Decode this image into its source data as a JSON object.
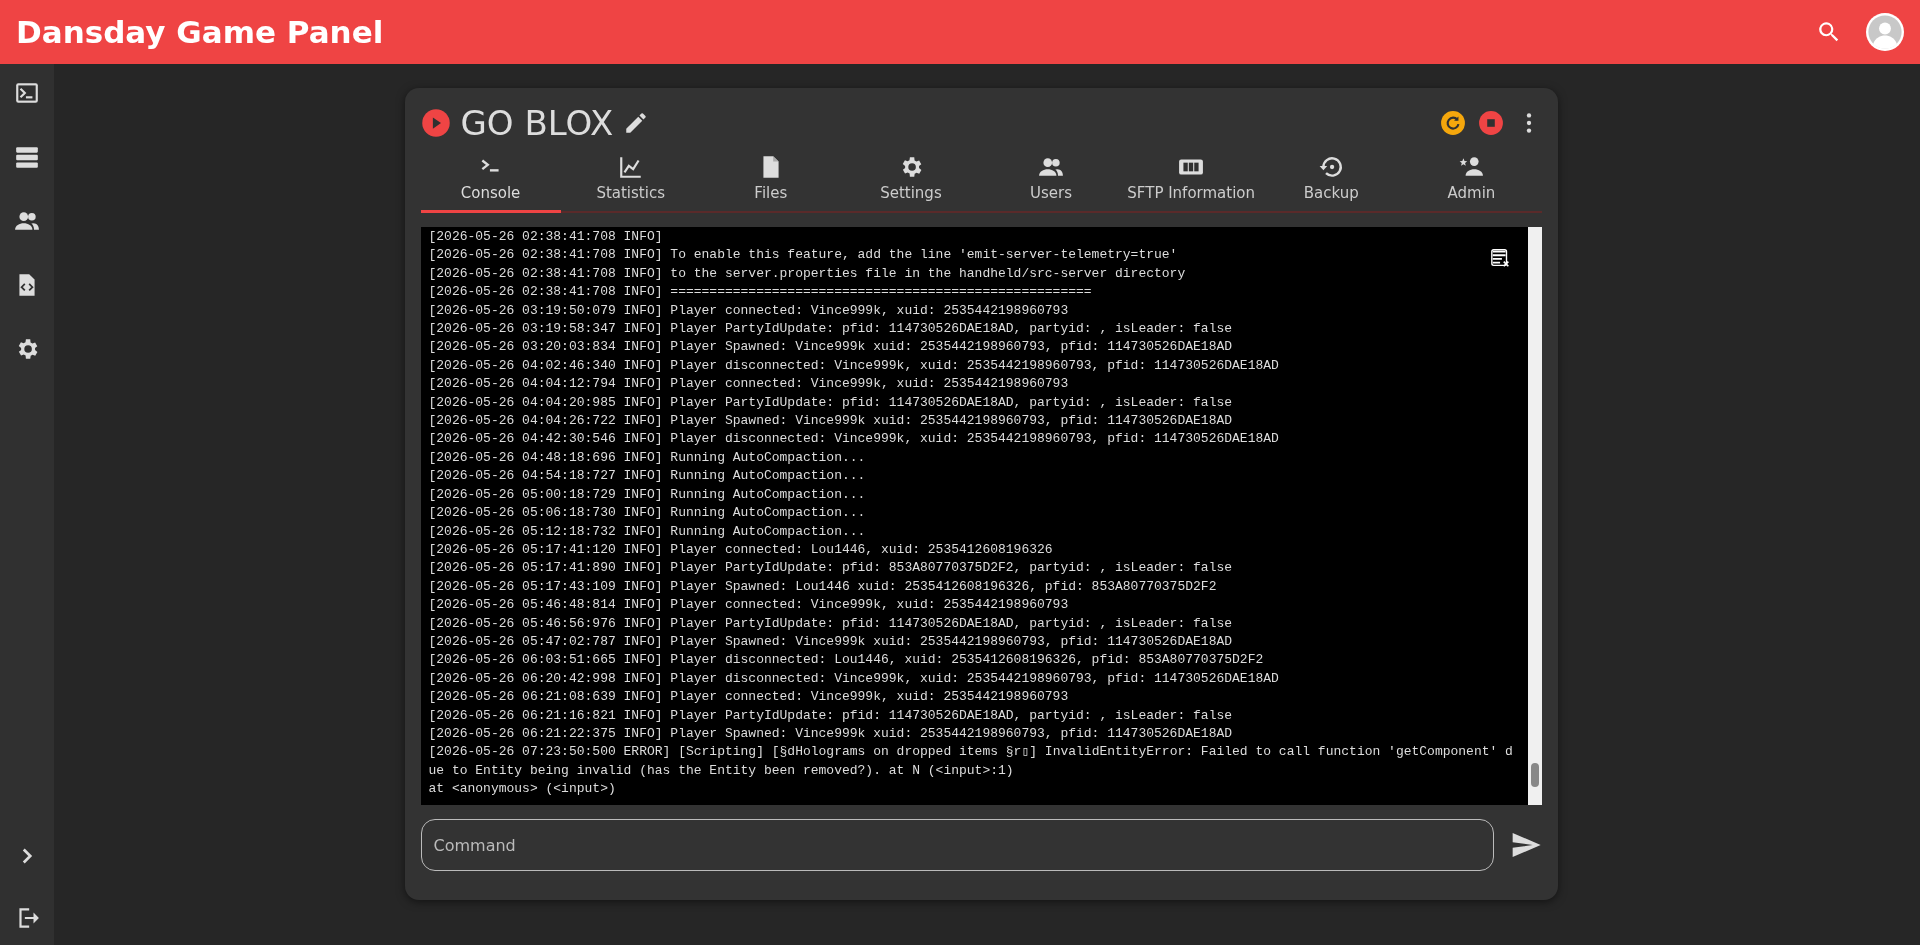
{
  "app_bar": {
    "title": "Dansday Game Panel"
  },
  "server": {
    "name": "GO BLOX"
  },
  "tabs": [
    {
      "label": "Console",
      "selected": true
    },
    {
      "label": "Statistics",
      "selected": false
    },
    {
      "label": "Files",
      "selected": false
    },
    {
      "label": "Settings",
      "selected": false
    },
    {
      "label": "Users",
      "selected": false
    },
    {
      "label": "SFTP Information",
      "selected": false
    },
    {
      "label": "Backup",
      "selected": false
    },
    {
      "label": "Admin",
      "selected": false
    }
  ],
  "console": {
    "lines": [
      "[2026-05-26 02:38:41:708 INFO]",
      "[2026-05-26 02:38:41:708 INFO] To enable this feature, add the line 'emit-server-telemetry=true'",
      "[2026-05-26 02:38:41:708 INFO] to the server.properties file in the handheld/src-server directory",
      "[2026-05-26 02:38:41:708 INFO] ======================================================",
      "[2026-05-26 03:19:50:079 INFO] Player connected: Vince999k, xuid: 2535442198960793",
      "[2026-05-26 03:19:58:347 INFO] Player PartyIdUpdate: pfid: 114730526DAE18AD, partyid: , isLeader: false",
      "[2026-05-26 03:20:03:834 INFO] Player Spawned: Vince999k xuid: 2535442198960793, pfid: 114730526DAE18AD",
      "[2026-05-26 04:02:46:340 INFO] Player disconnected: Vince999k, xuid: 2535442198960793, pfid: 114730526DAE18AD",
      "[2026-05-26 04:04:12:794 INFO] Player connected: Vince999k, xuid: 2535442198960793",
      "[2026-05-26 04:04:20:985 INFO] Player PartyIdUpdate: pfid: 114730526DAE18AD, partyid: , isLeader: false",
      "[2026-05-26 04:04:26:722 INFO] Player Spawned: Vince999k xuid: 2535442198960793, pfid: 114730526DAE18AD",
      "[2026-05-26 04:42:30:546 INFO] Player disconnected: Vince999k, xuid: 2535442198960793, pfid: 114730526DAE18AD",
      "[2026-05-26 04:48:18:696 INFO] Running AutoCompaction...",
      "[2026-05-26 04:54:18:727 INFO] Running AutoCompaction...",
      "[2026-05-26 05:00:18:729 INFO] Running AutoCompaction...",
      "[2026-05-26 05:06:18:730 INFO] Running AutoCompaction...",
      "[2026-05-26 05:12:18:732 INFO] Running AutoCompaction...",
      "[2026-05-26 05:17:41:120 INFO] Player connected: Lou1446, xuid: 2535412608196326",
      "[2026-05-26 05:17:41:890 INFO] Player PartyIdUpdate: pfid: 853A80770375D2F2, partyid: , isLeader: false",
      "[2026-05-26 05:17:43:109 INFO] Player Spawned: Lou1446 xuid: 2535412608196326, pfid: 853A80770375D2F2",
      "[2026-05-26 05:46:48:814 INFO] Player connected: Vince999k, xuid: 2535442198960793",
      "[2026-05-26 05:46:56:976 INFO] Player PartyIdUpdate: pfid: 114730526DAE18AD, partyid: , isLeader: false",
      "[2026-05-26 05:47:02:787 INFO] Player Spawned: Vince999k xuid: 2535442198960793, pfid: 114730526DAE18AD",
      "[2026-05-26 06:03:51:665 INFO] Player disconnected: Lou1446, xuid: 2535412608196326, pfid: 853A80770375D2F2",
      "[2026-05-26 06:20:42:998 INFO] Player disconnected: Vince999k, xuid: 2535442198960793, pfid: 114730526DAE18AD",
      "[2026-05-26 06:21:08:639 INFO] Player connected: Vince999k, xuid: 2535442198960793",
      "[2026-05-26 06:21:16:821 INFO] Player PartyIdUpdate: pfid: 114730526DAE18AD, partyid: , isLeader: false",
      "[2026-05-26 06:21:22:375 INFO] Player Spawned: Vince999k xuid: 2535442198960793, pfid: 114730526DAE18AD",
      "[2026-05-26 07:23:50:500 ERROR] [Scripting] [§dHolograms on dropped items §r▯] InvalidEntityError: Failed to call function 'getComponent' due to Entity being invalid (has the Entity been removed?). at N (<input>:1)",
      "at <anonymous> (<input>)"
    ]
  },
  "command": {
    "placeholder": "Command"
  }
}
